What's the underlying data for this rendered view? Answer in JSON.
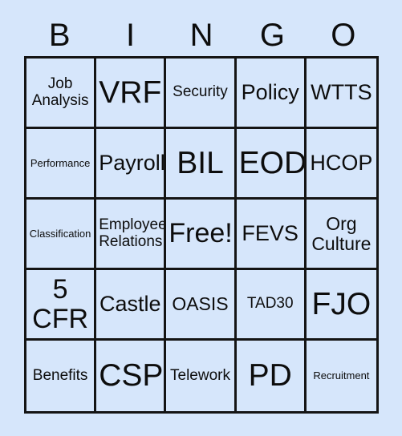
{
  "card": {
    "title_letters": [
      "B",
      "I",
      "N",
      "G",
      "O"
    ],
    "free_space_label": "Free!",
    "colors": {
      "background": "#d6e6fb",
      "cell_fill": "#d6e6fb",
      "grid_line": "#141414",
      "text": "#0d0d0d"
    },
    "columns": [
      {
        "letter": "B",
        "cells": [
          "Job\nAnalysis",
          "Performance",
          "Classification",
          "5\nCFR",
          "Benefits"
        ]
      },
      {
        "letter": "I",
        "cells": [
          "VRF",
          "Payroll",
          "Employee\nRelations",
          "Castle",
          "CSP"
        ]
      },
      {
        "letter": "N",
        "cells": [
          "Security",
          "BIL",
          "Free!",
          "OASIS",
          "Telework"
        ]
      },
      {
        "letter": "G",
        "cells": [
          "Policy",
          "EOD",
          "FEVS",
          "TAD30",
          "PD"
        ]
      },
      {
        "letter": "O",
        "cells": [
          "WTTS",
          "HCOP",
          "Org\nCulture",
          "FJO",
          "Recruitment"
        ]
      }
    ],
    "rows": [
      {
        "index": 1,
        "cells": [
          {
            "text": "Job\nAnalysis",
            "size": "sz-m"
          },
          {
            "text": "VRF",
            "size": "sz-xxxl"
          },
          {
            "text": "Security",
            "size": "sz-m"
          },
          {
            "text": "Policy",
            "size": "sz-xl"
          },
          {
            "text": "WTTS",
            "size": "sz-xl"
          }
        ]
      },
      {
        "index": 2,
        "cells": [
          {
            "text": "Performance",
            "size": "sz-xs"
          },
          {
            "text": "Payroll",
            "size": "sz-xl"
          },
          {
            "text": "BIL",
            "size": "sz-xxxl"
          },
          {
            "text": "EOD",
            "size": "sz-xxxl"
          },
          {
            "text": "HCOP",
            "size": "sz-xl"
          }
        ]
      },
      {
        "index": 3,
        "cells": [
          {
            "text": "Classification",
            "size": "sz-xs"
          },
          {
            "text": "Employee\nRelations",
            "size": "sz-m"
          },
          {
            "text": "Free!",
            "size": "sz-xxl"
          },
          {
            "text": "FEVS",
            "size": "sz-xl"
          },
          {
            "text": "Org\nCulture",
            "size": "sz-l"
          }
        ]
      },
      {
        "index": 4,
        "cells": [
          {
            "text": "5\nCFR",
            "size": "sz-xxl"
          },
          {
            "text": "Castle",
            "size": "sz-xl"
          },
          {
            "text": "OASIS",
            "size": "sz-l"
          },
          {
            "text": "TAD30",
            "size": "sz-m"
          },
          {
            "text": "FJO",
            "size": "sz-xxxl"
          }
        ]
      },
      {
        "index": 5,
        "cells": [
          {
            "text": "Benefits",
            "size": "sz-m"
          },
          {
            "text": "CSP",
            "size": "sz-xxxl"
          },
          {
            "text": "Telework",
            "size": "sz-m"
          },
          {
            "text": "PD",
            "size": "sz-xxxl"
          },
          {
            "text": "Recruitment",
            "size": "sz-xs"
          }
        ]
      }
    ]
  }
}
